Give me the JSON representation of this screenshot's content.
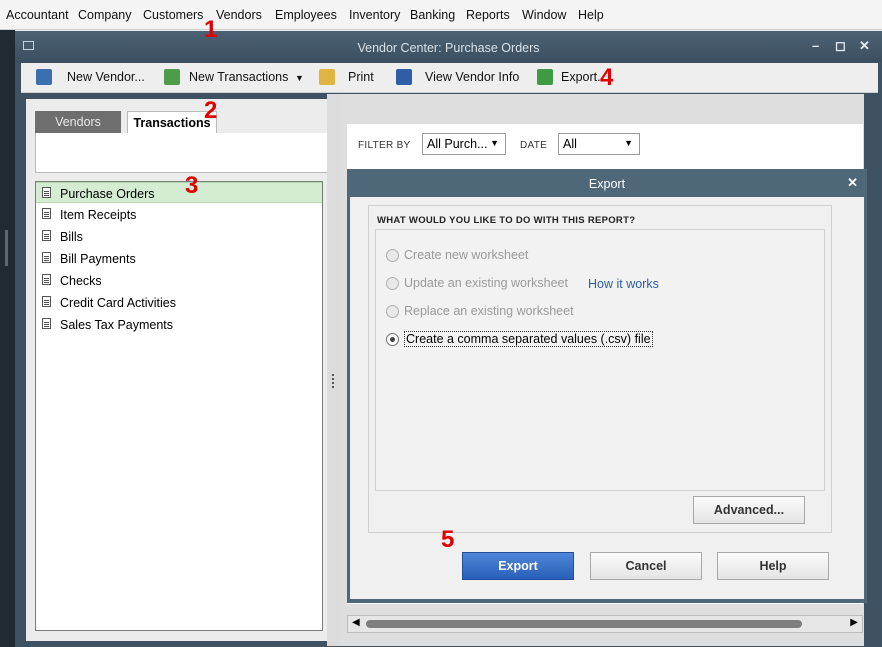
{
  "menu": [
    "Accountant",
    "Company",
    "Customers",
    "Vendors",
    "Employees",
    "Inventory",
    "Banking",
    "Reports",
    "Window",
    "Help"
  ],
  "window": {
    "title": "Vendor Center: Purchase Orders"
  },
  "toolbar": {
    "new_vendor": "New Vendor...",
    "new_transactions": "New Transactions",
    "print": "Print",
    "view_vendor_info": "View Vendor Info",
    "export": "Export..."
  },
  "tabs": {
    "vendors": "Vendors",
    "transactions": "Transactions"
  },
  "transaction_types": [
    "Purchase Orders",
    "Item Receipts",
    "Bills",
    "Bill Payments",
    "Checks",
    "Credit Card Activities",
    "Sales Tax Payments"
  ],
  "filter": {
    "filter_by_label": "FILTER BY",
    "filter_by_value": "All Purch...",
    "date_label": "DATE",
    "date_value": "All"
  },
  "dialog": {
    "title": "Export",
    "question": "WHAT WOULD YOU LIKE TO DO WITH THIS REPORT?",
    "options": [
      "Create new worksheet",
      "Update an existing worksheet",
      "Replace an existing worksheet",
      "Create a comma separated values (.csv) file"
    ],
    "how_it_works": "How it works",
    "advanced": "Advanced...",
    "export": "Export",
    "cancel": "Cancel",
    "help": "Help"
  },
  "steps": [
    "1",
    "2",
    "3",
    "4",
    "5"
  ],
  "colors": {
    "title_bar": "#3e5264",
    "selected_row": "#d4ecd2",
    "export_button": "#2f67c1",
    "step_marker": "#e00000"
  }
}
